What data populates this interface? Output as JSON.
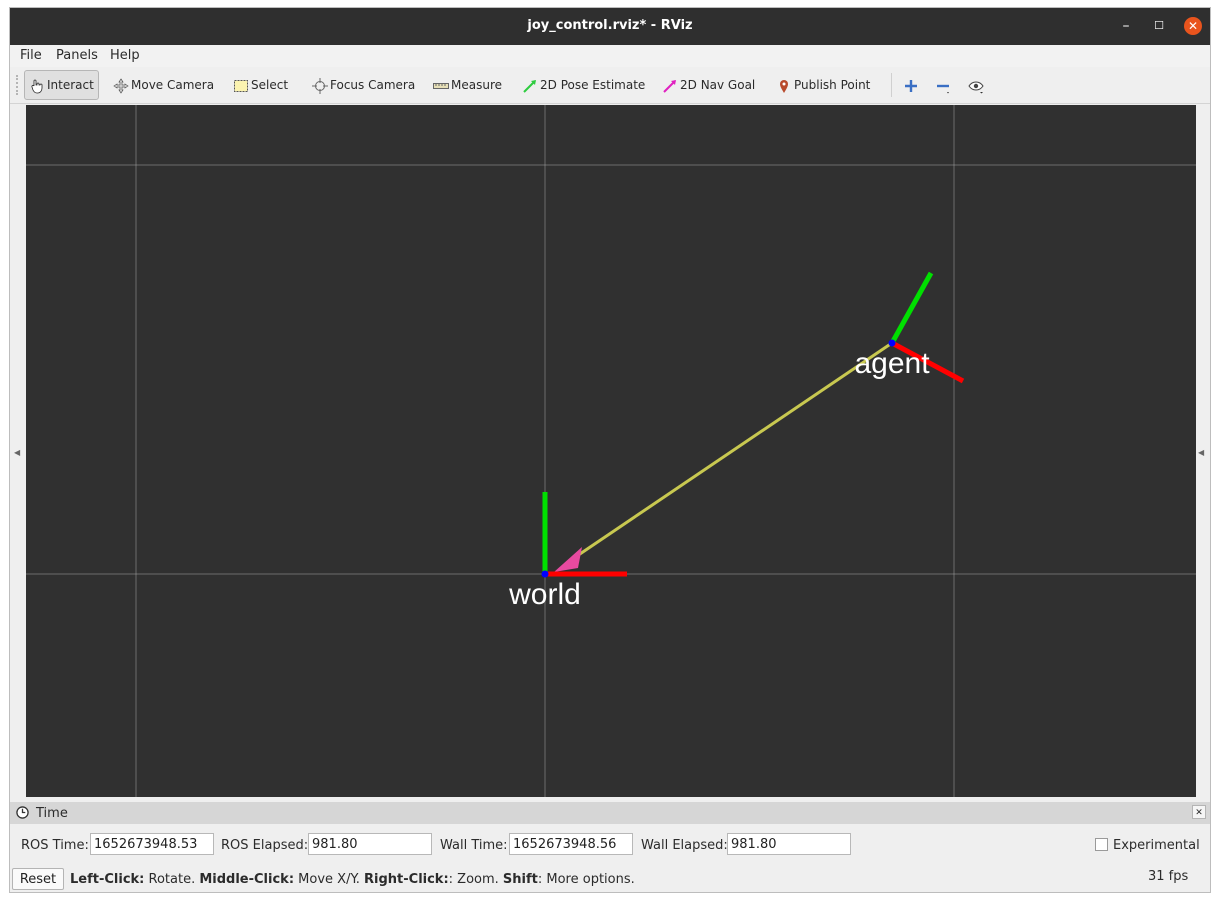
{
  "window": {
    "title": "joy_control.rviz* - RViz"
  },
  "menu": {
    "file": "File",
    "panels": "Panels",
    "help": "Help"
  },
  "toolbar": {
    "interact": "Interact",
    "move_camera": "Move Camera",
    "select": "Select",
    "focus_camera": "Focus Camera",
    "measure": "Measure",
    "pose_estimate": "2D Pose Estimate",
    "nav_goal": "2D Nav Goal",
    "publish_point": "Publish Point"
  },
  "viewport": {
    "frames": [
      {
        "name": "world"
      },
      {
        "name": "agent"
      }
    ]
  },
  "time_panel": {
    "title": "Time",
    "ros_time_label": "ROS Time:",
    "ros_time": "1652673948.53",
    "ros_elapsed_label": "ROS Elapsed:",
    "ros_elapsed": "981.80",
    "wall_time_label": "Wall Time:",
    "wall_time": "1652673948.56",
    "wall_elapsed_label": "Wall Elapsed:",
    "wall_elapsed": "981.80",
    "experimental_label": "Experimental",
    "experimental_checked": false
  },
  "status": {
    "reset": "Reset",
    "hint_left_key": "Left-Click:",
    "hint_left_val": " Rotate. ",
    "hint_middle_key": "Middle-Click:",
    "hint_middle_val": " Move X/Y. ",
    "hint_right_key": "Right-Click:",
    "hint_right_val": ": Zoom. ",
    "hint_shift_key": "Shift",
    "hint_shift_val": ": More options.",
    "fps": "31 fps"
  },
  "colors": {
    "viewport_bg": "#303030",
    "grid": "#a0a0a0",
    "x_axis": "#ff0000",
    "y_axis": "#00e000",
    "link": "#c8c850",
    "arrow_head": "#e84aa0",
    "origin": "#0000ff"
  }
}
